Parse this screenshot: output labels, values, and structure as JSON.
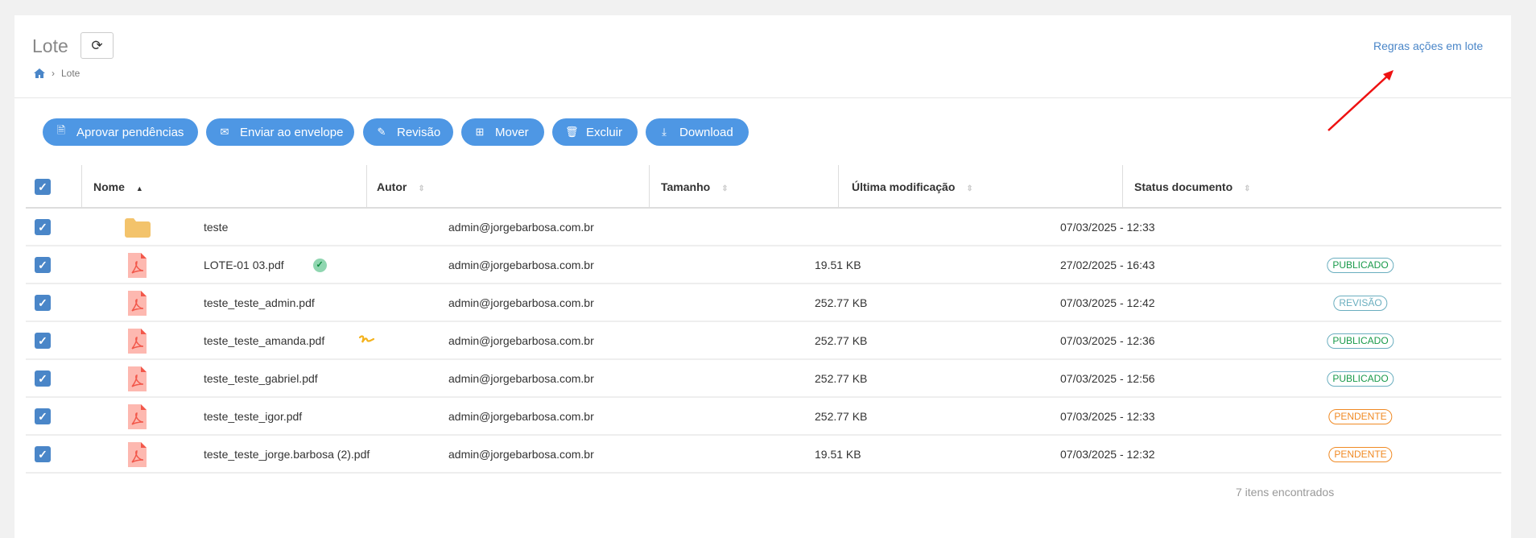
{
  "header": {
    "title": "Lote",
    "breadcrumb": [
      "Lote"
    ],
    "rules_link": "Regras ações em lote"
  },
  "toolbar": [
    {
      "label": "Aprovar pendências",
      "icon": "file-check-icon"
    },
    {
      "label": "Enviar ao envelope",
      "icon": "envelope-icon"
    },
    {
      "label": "Revisão",
      "icon": "edit-icon"
    },
    {
      "label": "Mover",
      "icon": "tree-icon"
    },
    {
      "label": "Excluir",
      "icon": "trash-icon"
    },
    {
      "label": "Download",
      "icon": "download-icon"
    }
  ],
  "columns": [
    "Nome",
    "Autor",
    "Tamanho",
    "Última modificação",
    "Status documento"
  ],
  "rows": [
    {
      "type": "folder",
      "name": "teste",
      "author": "admin@jorgebarbosa.com.br",
      "size": "",
      "modified": "07/03/2025 - 12:33",
      "status": "",
      "badge": ""
    },
    {
      "type": "pdf",
      "name": "LOTE-01 03.pdf",
      "author": "admin@jorgebarbosa.com.br",
      "size": "19.51 KB",
      "modified": "27/02/2025 - 16:43",
      "status": "PUBLICADO",
      "badge": "check"
    },
    {
      "type": "pdf",
      "name": "teste_teste_admin.pdf",
      "author": "admin@jorgebarbosa.com.br",
      "size": "252.77 KB",
      "modified": "07/03/2025 - 12:42",
      "status": "REVISÃO",
      "badge": ""
    },
    {
      "type": "pdf",
      "name": "teste_teste_amanda.pdf",
      "author": "admin@jorgebarbosa.com.br",
      "size": "252.77 KB",
      "modified": "07/03/2025 - 12:36",
      "status": "PUBLICADO",
      "badge": "signature"
    },
    {
      "type": "pdf",
      "name": "teste_teste_gabriel.pdf",
      "author": "admin@jorgebarbosa.com.br",
      "size": "252.77 KB",
      "modified": "07/03/2025 - 12:56",
      "status": "PUBLICADO",
      "badge": ""
    },
    {
      "type": "pdf",
      "name": "teste_teste_igor.pdf",
      "author": "admin@jorgebarbosa.com.br",
      "size": "252.77 KB",
      "modified": "07/03/2025 - 12:33",
      "status": "PENDENTE",
      "badge": ""
    },
    {
      "type": "pdf",
      "name": "teste_teste_jorge.barbosa (2).pdf",
      "author": "admin@jorgebarbosa.com.br",
      "size": "19.51 KB",
      "modified": "07/03/2025 - 12:32",
      "status": "PENDENTE",
      "badge": ""
    }
  ],
  "footer": "7 itens encontrados",
  "colors": {
    "primary": "#4e97e4",
    "published": "#1a9a4a",
    "review": "#6aaebf",
    "pending": "#f08a24",
    "annotation_arrow": "#ee1111"
  }
}
